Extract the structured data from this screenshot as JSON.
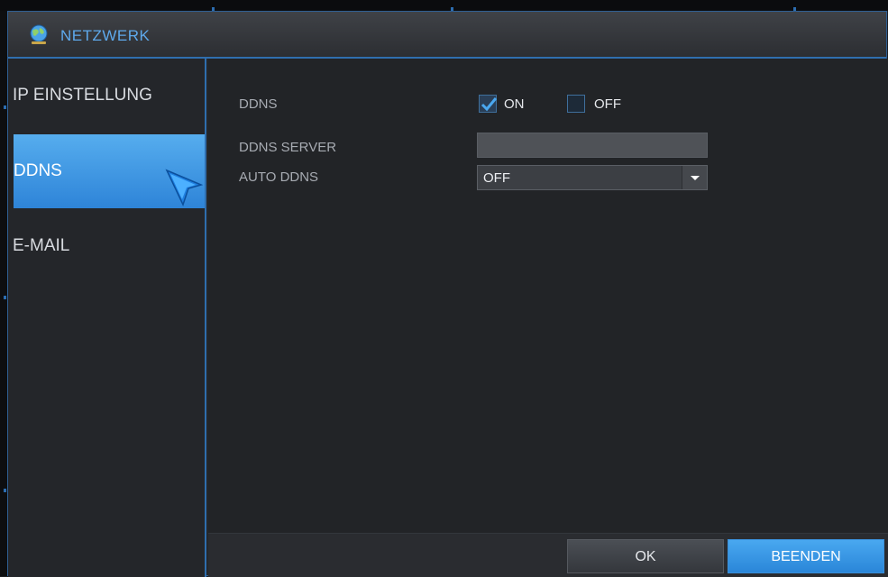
{
  "window": {
    "title": "NETZWERK",
    "icon": "globe-network-icon"
  },
  "sidebar": {
    "items": [
      {
        "label": "IP EINSTELLUNG",
        "active": false
      },
      {
        "label": "DDNS",
        "active": true
      },
      {
        "label": "E-MAIL",
        "active": false
      }
    ]
  },
  "form": {
    "ddns": {
      "label": "DDNS",
      "on_label": "ON",
      "off_label": "OFF",
      "on_checked": true,
      "off_checked": false
    },
    "server": {
      "label": "DDNS SERVER",
      "value": ""
    },
    "auto": {
      "label": "AUTO DDNS",
      "value": "OFF"
    }
  },
  "buttons": {
    "ok": "OK",
    "exit": "BEENDEN"
  },
  "colors": {
    "accent": "#2e84d8",
    "title": "#5ea9ec",
    "border": "#2f6eae"
  }
}
